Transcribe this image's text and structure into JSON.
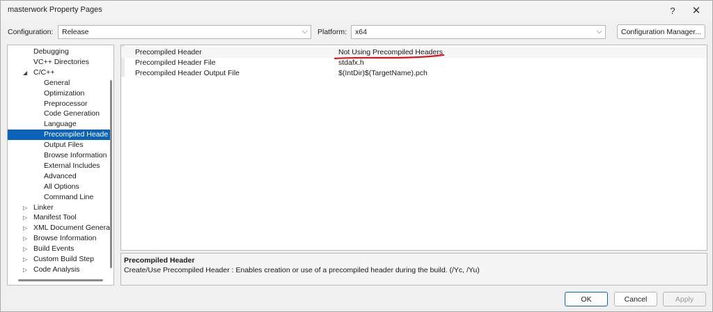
{
  "window": {
    "title": "masterwork Property Pages",
    "help_glyph": "?",
    "close_glyph": "✕"
  },
  "toolbar": {
    "configuration_label": "Configuration:",
    "configuration_value": "Release",
    "platform_label": "Platform:",
    "platform_value": "x64",
    "configuration_manager_label": "Configuration Manager..."
  },
  "tree": {
    "items": [
      {
        "label": "Debugging",
        "level": 2
      },
      {
        "label": "VC++ Directories",
        "level": 2
      },
      {
        "label": "C/C++",
        "level": 2,
        "expander": "◢"
      },
      {
        "label": "General",
        "level": 3
      },
      {
        "label": "Optimization",
        "level": 3
      },
      {
        "label": "Preprocessor",
        "level": 3
      },
      {
        "label": "Code Generation",
        "level": 3
      },
      {
        "label": "Language",
        "level": 3
      },
      {
        "label": "Precompiled Heade",
        "level": 3,
        "selected": true
      },
      {
        "label": "Output Files",
        "level": 3
      },
      {
        "label": "Browse Information",
        "level": 3
      },
      {
        "label": "External Includes",
        "level": 3
      },
      {
        "label": "Advanced",
        "level": 3
      },
      {
        "label": "All Options",
        "level": 3
      },
      {
        "label": "Command Line",
        "level": 3
      },
      {
        "label": "Linker",
        "level": 2,
        "expander": "▷"
      },
      {
        "label": "Manifest Tool",
        "level": 2,
        "expander": "▷"
      },
      {
        "label": "XML Document Genera",
        "level": 2,
        "expander": "▷"
      },
      {
        "label": "Browse Information",
        "level": 2,
        "expander": "▷"
      },
      {
        "label": "Build Events",
        "level": 2,
        "expander": "▷"
      },
      {
        "label": "Custom Build Step",
        "level": 2,
        "expander": "▷"
      },
      {
        "label": "Code Analysis",
        "level": 2,
        "expander": "▷"
      }
    ]
  },
  "properties": [
    {
      "name": "Precompiled Header",
      "value": "Not Using Precompiled Headers"
    },
    {
      "name": "Precompiled Header File",
      "value": "stdafx.h"
    },
    {
      "name": "Precompiled Header Output File",
      "value": "$(IntDir)$(TargetName).pch"
    }
  ],
  "description": {
    "title": "Precompiled Header",
    "text": "Create/Use Precompiled Header : Enables creation or use of a precompiled header during the build.     (/Yc, /Yu)"
  },
  "buttons": {
    "ok": "OK",
    "cancel": "Cancel",
    "apply": "Apply"
  },
  "colors": {
    "selection": "#0a63b8",
    "annotation": "#e0141e"
  },
  "icons": {
    "dropdown": "⌵"
  }
}
